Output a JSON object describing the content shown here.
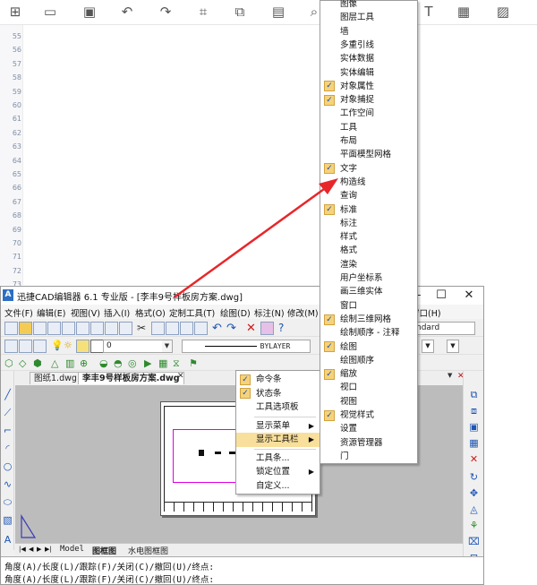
{
  "editor": {
    "line_numbers": [
      "55",
      "56",
      "57",
      "58",
      "59",
      "60",
      "61",
      "62",
      "63",
      "64",
      "65",
      "66",
      "67",
      "68",
      "69",
      "70",
      "71",
      "72",
      "73"
    ]
  },
  "cad": {
    "title": "迅捷CAD编辑器 6.1 专业版  - [李丰9号样板房方案.dwg]",
    "window_controls": {
      "minimize": "—",
      "maximize": "☐",
      "close": "✕"
    },
    "menus": [
      "文件(F)",
      "编辑(E)",
      "视图(V)",
      "插入(I)",
      "格式(O)",
      "定制工具(T)",
      "绘图(D)",
      "标注(N)",
      "修改(M)",
      "窗口(H)"
    ],
    "toolbar": {
      "layer_value": "0",
      "linetype_value": "BYLAYER",
      "style_partial": "ndard"
    },
    "doc_tabs": [
      "图纸1.dwg",
      "李丰9号样板房方案.dwg"
    ],
    "tab_close": "✕",
    "layout_tabs": [
      "Model",
      "图框图",
      "水电图框图"
    ],
    "command_lines": [
      "角度(A)/长度(L)/跟踪(F)/关闭(C)/撤回(U)/终点:",
      "角度(A)/长度(L)/跟踪(F)/关闭(C)/撤回(U)/终点:"
    ]
  },
  "context_menu": {
    "items": [
      {
        "label": "命令条",
        "checked": true
      },
      {
        "label": "状态条",
        "checked": true
      },
      {
        "label": "工具选项板",
        "checked": false
      },
      {
        "label": "显示菜单",
        "checked": false,
        "submenu": true
      },
      {
        "label": "显示工具栏",
        "checked": false,
        "submenu": true,
        "highlighted": true
      },
      {
        "label": "工具条...",
        "checked": false
      },
      {
        "label": "锁定位置",
        "checked": false,
        "submenu": true
      },
      {
        "label": "自定义...",
        "checked": false
      }
    ],
    "submenu_arrow": "▶",
    "check_mark": "✓"
  },
  "toolbar_list": {
    "items": [
      {
        "label": "图像",
        "checked": false
      },
      {
        "label": "图层工具",
        "checked": false
      },
      {
        "label": "墙",
        "checked": false
      },
      {
        "label": "多重引线",
        "checked": false
      },
      {
        "label": "实体数据",
        "checked": false
      },
      {
        "label": "实体编辑",
        "checked": false
      },
      {
        "label": "对象属性",
        "checked": true
      },
      {
        "label": "对象捕捉",
        "checked": true
      },
      {
        "label": "工作空间",
        "checked": false
      },
      {
        "label": "工具",
        "checked": false
      },
      {
        "label": "布局",
        "checked": false
      },
      {
        "label": "平面模型网格",
        "checked": false
      },
      {
        "label": "文字",
        "checked": true
      },
      {
        "label": "构造线",
        "checked": false
      },
      {
        "label": "查询",
        "checked": false
      },
      {
        "label": "标准",
        "checked": true
      },
      {
        "label": "标注",
        "checked": false
      },
      {
        "label": "样式",
        "checked": false
      },
      {
        "label": "格式",
        "checked": false
      },
      {
        "label": "渲染",
        "checked": false
      },
      {
        "label": "用户坐标系",
        "checked": false
      },
      {
        "label": "画三维实体",
        "checked": false
      },
      {
        "label": "窗口",
        "checked": false
      },
      {
        "label": "绘制三维网格",
        "checked": true
      },
      {
        "label": "绘制顺序 - 注释",
        "checked": false
      },
      {
        "label": "绘图",
        "checked": true
      },
      {
        "label": "绘图顺序",
        "checked": false
      },
      {
        "label": "缩放",
        "checked": true
      },
      {
        "label": "视口",
        "checked": false
      },
      {
        "label": "视图",
        "checked": false
      },
      {
        "label": "视觉样式",
        "checked": true
      },
      {
        "label": "设置",
        "checked": false
      },
      {
        "label": "资源管理器",
        "checked": false
      },
      {
        "label": "门",
        "checked": false
      }
    ]
  },
  "colors": {
    "menu_highlight": "#f8df9c",
    "check_bg": "#f6d27a",
    "arrow": "#e8262a",
    "canvas": "#bcbcbc"
  }
}
